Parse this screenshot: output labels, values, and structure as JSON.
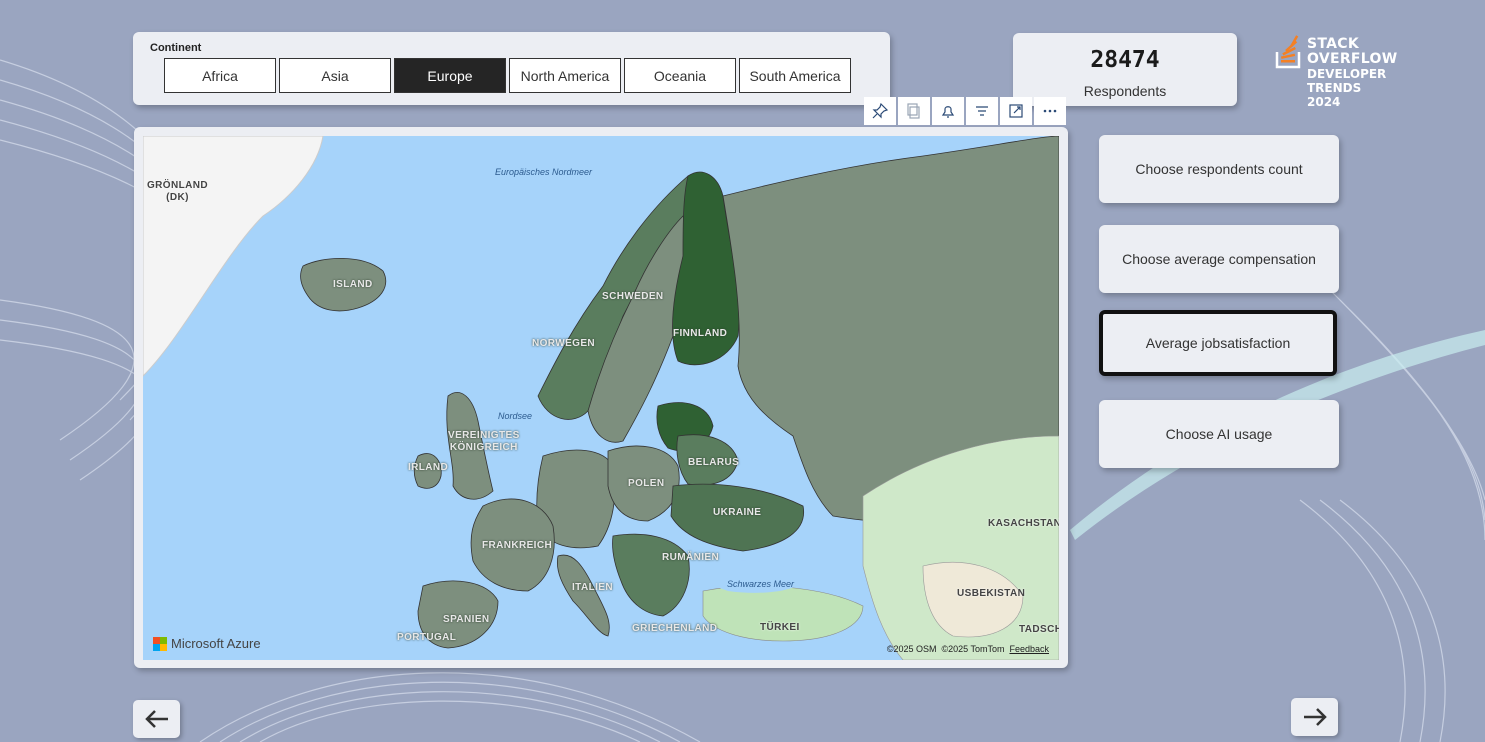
{
  "slicer": {
    "title": "Continent",
    "options": [
      "Africa",
      "Asia",
      "Europe",
      "North America",
      "Oceania",
      "South America"
    ],
    "selected": "Europe"
  },
  "kpi": {
    "value": "28474",
    "label": "Respondents"
  },
  "logo": {
    "line1": "STACK",
    "line2": "OVERFLOW",
    "line3": "DEVELOPER",
    "line4": "TRENDS",
    "line5": "2024"
  },
  "toolbar": {
    "icons": [
      "pin-icon",
      "copy-icon",
      "bell-icon",
      "filter-icon",
      "focus-mode-icon",
      "more-options-icon"
    ]
  },
  "map": {
    "country_labels": {
      "groenland": "GRÖNLAND\n(DK)",
      "island": "ISLAND",
      "schweden": "SCHWEDEN",
      "norwegen": "NORWEGEN",
      "finnland": "FINNLAND",
      "vk": "VEREINIGTES\nKÖNIGREICH",
      "irland": "IRLAND",
      "belarus": "BELARUS",
      "polen": "POLEN",
      "ukraine": "UKRAINE",
      "frankreich": "FRANKREICH",
      "rumaenien": "RUMÄNIEN",
      "italien": "ITALIEN",
      "spanien": "SPANIEN",
      "portugal": "PORTUGAL",
      "griechenland": "GRIECHENLAND",
      "tuerkei": "TÜRKEI",
      "kasachstan": "KASACHSTAN",
      "usbekistan": "USBEKISTAN",
      "tadsch": "TADSCH"
    },
    "sea_labels": {
      "nordmeer": "Europäisches Nordmeer",
      "nordsee": "Nordsee",
      "schwarzes": "Schwarzes Meer"
    },
    "brand": "Microsoft Azure",
    "copyright_osm": "©2025 OSM",
    "copyright_tomtom": "©2025 TomTom",
    "feedback": "Feedback",
    "colors": {
      "water": "#a6d3fa",
      "low": "#7d8f7e",
      "mid": "#5a7d5e",
      "high": "#2f6133"
    }
  },
  "buttons": [
    {
      "label": "Choose respondents count",
      "active": false
    },
    {
      "label": "Choose average compensation",
      "active": false
    },
    {
      "label": "Average jobsatisfaction",
      "active": true
    },
    {
      "label": "Choose AI usage",
      "active": false
    }
  ],
  "nav": {
    "back_icon": "arrow-left-icon",
    "next_icon": "arrow-right-icon"
  }
}
